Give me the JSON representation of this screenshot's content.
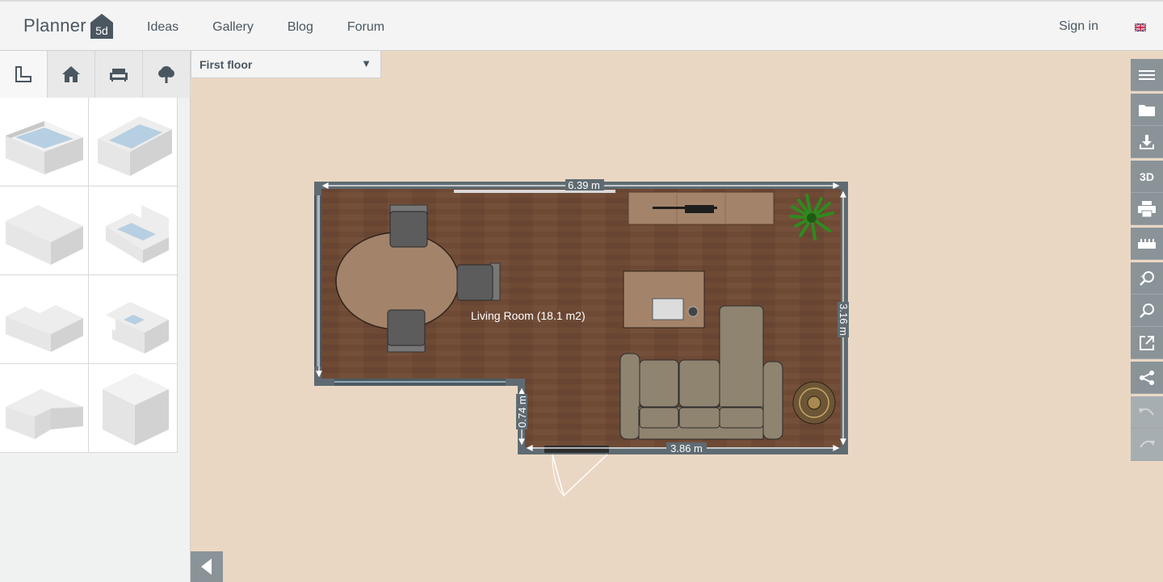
{
  "header": {
    "logo_text": "Planner",
    "logo_badge": "5d",
    "nav": [
      "Ideas",
      "Gallery",
      "Blog",
      "Forum"
    ],
    "sign_in": "Sign in",
    "language_icon": "uk-flag-icon"
  },
  "left_panel": {
    "tabs": [
      {
        "name": "rooms-tab",
        "icon": "room-outline-icon"
      },
      {
        "name": "house-tab",
        "icon": "house-icon"
      },
      {
        "name": "furniture-tab",
        "icon": "sofa-icon"
      },
      {
        "name": "exterior-tab",
        "icon": "tree-icon"
      }
    ],
    "room_shapes": [
      "rectangular-room-with-floor",
      "rectangular-room",
      "large-rectangular-room",
      "l-shaped-room-small",
      "l-shaped-room-wide",
      "cut-corner-room",
      "l-shaped-room",
      "solid-box"
    ]
  },
  "floor_select": {
    "label": "First floor"
  },
  "toolbar": [
    {
      "name": "menu-icon"
    },
    {
      "name": "folder-icon"
    },
    {
      "name": "download-icon"
    },
    {
      "name": "3d-view-button",
      "label": "3D"
    },
    {
      "name": "print-icon"
    },
    {
      "name": "ruler-icon"
    },
    {
      "name": "zoom-in-icon"
    },
    {
      "name": "zoom-out-icon"
    },
    {
      "name": "external-link-icon"
    },
    {
      "name": "share-icon"
    },
    {
      "name": "undo-icon",
      "disabled": true
    },
    {
      "name": "redo-icon",
      "disabled": true
    }
  ],
  "plan": {
    "room_label": "Living Room (18.1 m2)",
    "dimensions": {
      "top": "6.39 m",
      "right": "3.16 m",
      "bottom": "3.86 m",
      "step": "0.74 m"
    }
  },
  "colors": {
    "canvas": "#ead7c3",
    "floor": "#6e4a35",
    "wall": "#5f6b72",
    "toolbar": "#8a9398"
  }
}
